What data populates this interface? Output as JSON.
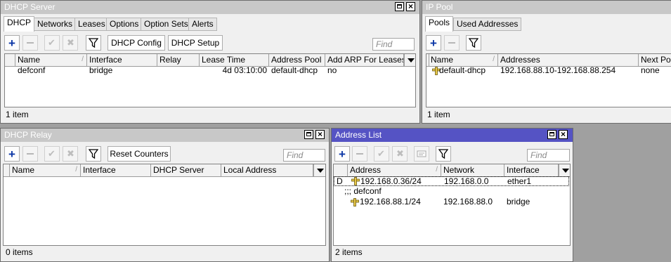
{
  "dhcp_server": {
    "title": "DHCP Server",
    "tabs": [
      "DHCP",
      "Networks",
      "Leases",
      "Options",
      "Option Sets",
      "Alerts"
    ],
    "buttons": {
      "config": "DHCP Config",
      "setup": "DHCP Setup"
    },
    "find_placeholder": "Find",
    "columns": [
      "Name",
      "Interface",
      "Relay",
      "Lease Time",
      "Address Pool",
      "Add ARP For Leases"
    ],
    "rows": [
      {
        "name": "defconf",
        "interface": "bridge",
        "relay": "",
        "lease_time": "4d 03:10:00",
        "address_pool": "default-dhcp",
        "add_arp": "no"
      }
    ],
    "status": "1 item"
  },
  "ip_pool": {
    "title": "IP Pool",
    "tabs": [
      "Pools",
      "Used Addresses"
    ],
    "find_placeholder": "",
    "columns": [
      "Name",
      "Addresses",
      "Next Pool"
    ],
    "rows": [
      {
        "name": "default-dhcp",
        "addresses": "192.168.88.10-192.168.88.254",
        "next_pool": "none"
      }
    ],
    "status": "1 item"
  },
  "dhcp_relay": {
    "title": "DHCP Relay",
    "buttons": {
      "reset": "Reset Counters"
    },
    "find_placeholder": "Find",
    "columns": [
      "Name",
      "Interface",
      "DHCP Server",
      "Local Address"
    ],
    "status": "0 items"
  },
  "address_list": {
    "title": "Address List",
    "find_placeholder": "Find",
    "columns": [
      "Address",
      "Network",
      "Interface"
    ],
    "rows": [
      {
        "flag": "D",
        "address": "192.168.0.36/24",
        "network": "192.168.0.0",
        "interface": "ether1"
      },
      {
        "comment": ";;; defconf"
      },
      {
        "flag": "",
        "address": "192.168.88.1/24",
        "network": "192.168.88.0",
        "interface": "bridge"
      }
    ],
    "status": "2 items"
  },
  "colors": {
    "active_title": "#5553c4",
    "inactive_title": "#c8c8c8",
    "add_blue": "#0b36a6"
  }
}
